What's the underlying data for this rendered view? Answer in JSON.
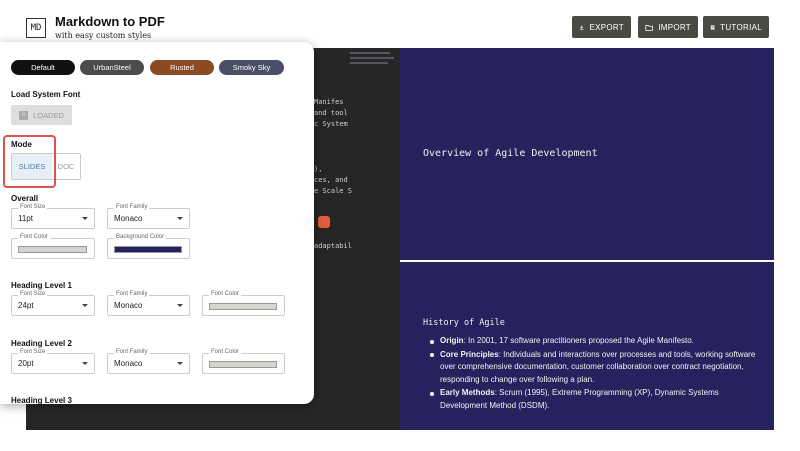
{
  "header": {
    "logo": "MD",
    "title": "Markdown to PDF",
    "subtitle": "with easy custom styles",
    "buttons": {
      "export": "EXPORT",
      "import": "IMPORT",
      "tutorial": "TUTORIAL"
    }
  },
  "editor": {
    "fragments": [
      "Manifes",
      "and tool",
      "c System",
      "),",
      "ces, and",
      "e Scale S",
      "adaptabil"
    ]
  },
  "preview": {
    "slide1_title": "Overview of Agile Development",
    "slide2_heading": "History of Agile",
    "bullets": [
      {
        "term": "Origin",
        "text": ": In 2001, 17 software practitioners proposed the Agile Manifesto."
      },
      {
        "term": "Core Principles",
        "text": ": Individuals and interactions over processes and tools, working software over comprehensive documentation, customer collaboration over contract negotiation, responding to change over following a plan."
      },
      {
        "term": "Early Methods",
        "text": ": Scrum (1995), Extreme Programming (XP), Dynamic Systems Development Method (DSDM)."
      }
    ],
    "colors": {
      "slide_bg": "#25225e",
      "text": "#ffffff"
    }
  },
  "panel": {
    "themes": [
      {
        "label": "Default",
        "color": "#111111"
      },
      {
        "label": "UrbanSteel",
        "color": "#4b4b4b"
      },
      {
        "label": "Rusted",
        "color": "#8a4a22"
      },
      {
        "label": "Smoky Sky",
        "color": "#4a4e66"
      }
    ],
    "load_font_label": "Load System Font",
    "loaded_label": "LOADED",
    "mode_label": "Mode",
    "mode_slides": "SLIDES",
    "mode_doc": "DOC",
    "overall": {
      "label": "Overall",
      "font_size_label": "Font Size",
      "font_size": "11pt",
      "font_family_label": "Font Family",
      "font_family": "Monaco",
      "font_color_label": "Font Color",
      "font_color": "#d4d4d0",
      "bg_color_label": "Background Color",
      "bg_color": "#25225e"
    },
    "h1": {
      "label": "Heading Level 1",
      "font_size_label": "Font Size",
      "font_size": "24pt",
      "font_family_label": "Font Family",
      "font_family": "Monaco",
      "font_color_label": "Font Color",
      "font_color": "#d4d4d0"
    },
    "h2": {
      "label": "Heading Level 2",
      "font_size_label": "Font Size",
      "font_size": "20pt",
      "font_family_label": "Font Family",
      "font_family": "Monaco",
      "font_color_label": "Font Color",
      "font_color": "#d4d4d0"
    },
    "h3": {
      "label": "Heading Level 3"
    }
  }
}
